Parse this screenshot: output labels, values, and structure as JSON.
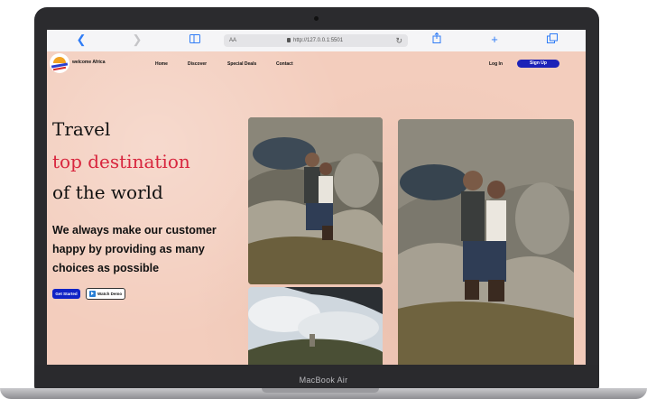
{
  "browser": {
    "reader_label": "AA",
    "url": "http://127.0.0.1:5501"
  },
  "device": {
    "model_label": "MacBook Air"
  },
  "site": {
    "brand": "welcome Africa",
    "nav": [
      "Home",
      "Discover",
      "Special Deals",
      "Contact"
    ],
    "login": "Log In",
    "signup": "Sign Up"
  },
  "hero": {
    "line1": "Travel",
    "line2": "top destination",
    "line3": "of the world",
    "tagline": "We always make our customer happy by providing as many choices as possible",
    "cta_primary": "Get Started",
    "cta_secondary": "Watch Demo"
  },
  "colors": {
    "accent_red": "#d8263e",
    "primary_blue": "#1c22b8",
    "page_bg": "#f3cdbd"
  }
}
